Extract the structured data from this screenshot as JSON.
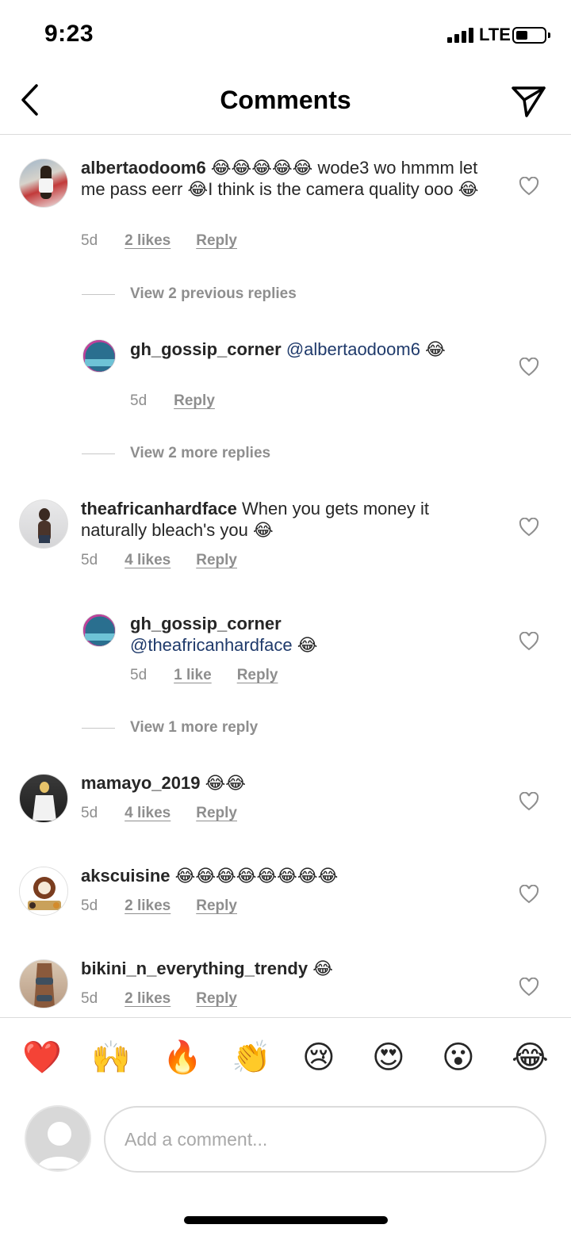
{
  "status_bar": {
    "time": "9:23",
    "network": "LTE"
  },
  "header": {
    "title": "Comments"
  },
  "comments": [
    {
      "username": "albertaodoom6",
      "text": "😂😂😂😂😂 wode3 wo hmmm let me pass eerr 😂I think is the camera quality ooo 😂",
      "time": "5d",
      "likes": "2 likes",
      "reply": "Reply"
    },
    {
      "view_previous": "View 2 previous replies"
    },
    {
      "username": "gh_gossip_corner",
      "mention": "@albertaodoom6",
      "text": "😂",
      "time": "5d",
      "reply": "Reply",
      "avatar_text": "GH GOSSIP CORNER"
    },
    {
      "view_more": "View 2 more replies"
    },
    {
      "username": "theafricanhardface",
      "text": "When you gets money it naturally bleach's you 😂",
      "time": "5d",
      "likes": "4 likes",
      "reply": "Reply"
    },
    {
      "username": "gh_gossip_corner",
      "mention": "@theafricanhardface",
      "text": "😂",
      "time": "5d",
      "likes": "1 like",
      "reply": "Reply",
      "avatar_text": "GH GOSSIP CORNER"
    },
    {
      "view_more": "View 1 more reply"
    },
    {
      "username": "mamayo_2019",
      "text": "😂😂",
      "time": "5d",
      "likes": "4 likes",
      "reply": "Reply"
    },
    {
      "username": "akscuisine",
      "text": "😂😂😂😂😂😂😂😂",
      "time": "5d",
      "likes": "2 likes",
      "reply": "Reply"
    },
    {
      "username": "bikini_n_everything_trendy",
      "text": "😂",
      "time": "5d",
      "likes": "2 likes",
      "reply": "Reply"
    }
  ],
  "emoji_bar": [
    "❤️",
    "🙌",
    "🔥",
    "👏",
    "😢",
    "😍",
    "😮",
    "😂"
  ],
  "composer": {
    "placeholder": "Add a comment..."
  },
  "colors": {
    "text": "#262626",
    "meta": "#8e8e8e",
    "mention": "#1f3a6b",
    "divider": "#dbdbdb"
  },
  "icons": [
    "back-chevron-icon",
    "send-icon",
    "heart-outline-icon",
    "default-avatar-icon"
  ]
}
